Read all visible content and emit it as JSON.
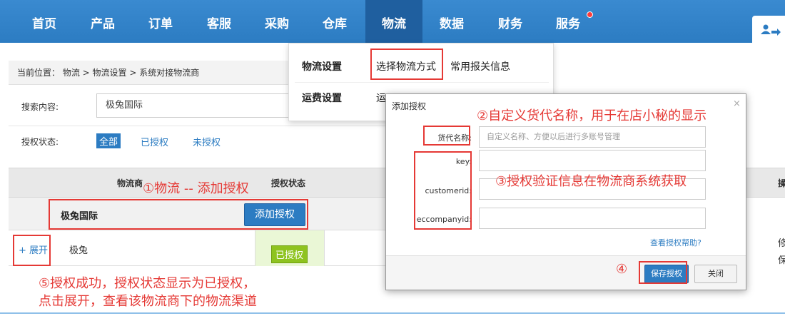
{
  "nav": {
    "items": [
      "首页",
      "产品",
      "订单",
      "客服",
      "采购",
      "仓库",
      "物流",
      "数据",
      "财务",
      "服务"
    ]
  },
  "colors": {
    "nav_bg": "#2c7cc2",
    "accent": "#2c7cc2",
    "annotation": "#e53935",
    "authorized": "#8ec31f"
  },
  "breadcrumb": {
    "label": "当前位置：",
    "path": "物流 > 物流设置 > 系统对接物流商"
  },
  "filters": {
    "search_label": "搜索内容:",
    "search_value": "极兔国际",
    "status_label": "授权状态:",
    "options": [
      "全部",
      "已授权",
      "未授权"
    ]
  },
  "table": {
    "col_provider": "物流商",
    "col_status": "授权状态",
    "right_header": "操",
    "group_name": "极兔国际",
    "add_auth_button": "添加授权",
    "row": {
      "expand": "+ 展开",
      "name": "极兔",
      "status": "已授权"
    },
    "right_ops": [
      "修",
      "保"
    ]
  },
  "dropdown": {
    "logistics_settings": "物流设置",
    "choose_method": "选择物流方式",
    "customs_info": "常用报关信息",
    "freight_settings": "运费设置",
    "freight_sub": "运"
  },
  "dialog": {
    "title": "添加授权",
    "close": "×",
    "forwarder_label": "货代名称:",
    "forwarder_placeholder": "自定义名称、方便以后进行多账号管理",
    "key_label": "key:",
    "customerid_label": "customerid:",
    "eccompanyid_label": "eccompanyid:",
    "help_link": "查看授权帮助?",
    "save_button": "保存授权",
    "close_button": "关闭"
  },
  "annotations": {
    "a1": "①物流 -- 添加授权",
    "a2": "②自定义货代名称，用于在店小秘的显示",
    "a3": "③授权验证信息在物流商系统获取",
    "a4": "④",
    "a5_line1": "⑤授权成功，授权状态显示为已授权，",
    "a5_line2": "点击展开，查看该物流商下的物流渠道"
  }
}
